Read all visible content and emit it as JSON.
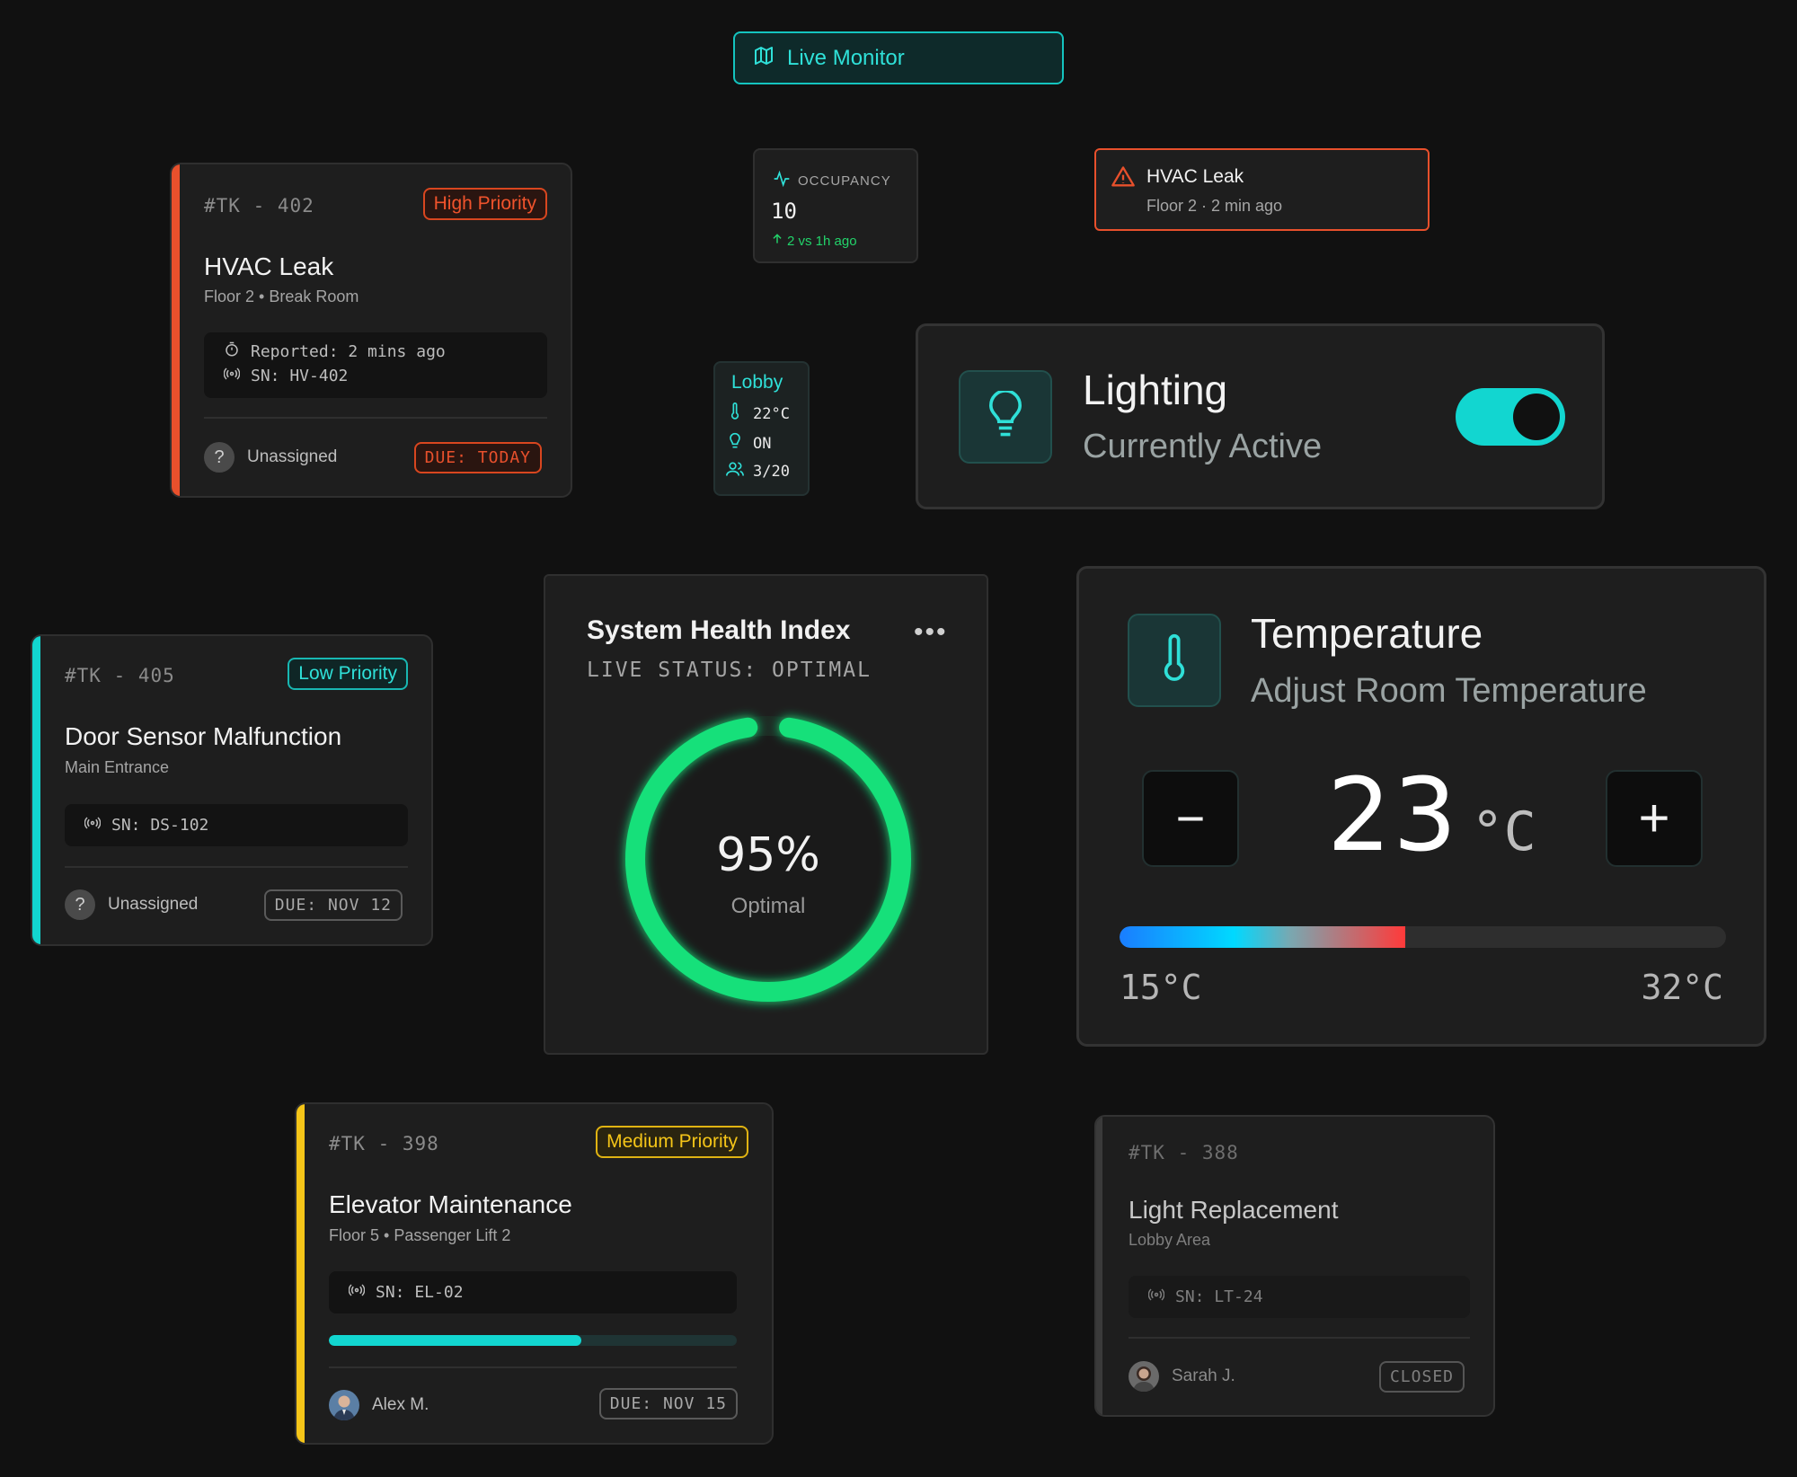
{
  "live_monitor": {
    "label": "Live Monitor",
    "icon": "map-icon"
  },
  "occupancy": {
    "label": "OCCUPANCY",
    "value": "10",
    "delta": "2 vs 1h ago",
    "icon": "activity-icon"
  },
  "alert": {
    "title": "HVAC Leak",
    "subtitle": "Floor 2 · 2 min ago",
    "icon": "warning-icon",
    "color": "#e8502c"
  },
  "lobby": {
    "title": "Lobby",
    "temp": "22°C",
    "light": "ON",
    "occupancy": "3/20"
  },
  "lighting": {
    "title": "Lighting",
    "status": "Currently Active",
    "toggle_on": true,
    "icon": "lightbulb-icon",
    "accent": "#12d6d0"
  },
  "health": {
    "title": "System Health Index",
    "status": "LIVE STATUS: OPTIMAL",
    "percent": 95,
    "percent_label": "95%",
    "state_label": "Optimal",
    "color": "#12e07a"
  },
  "temperature": {
    "title": "Temperature",
    "subtitle": "Adjust Room Temperature",
    "value": "23",
    "unit": "°C",
    "minus": "−",
    "plus": "+",
    "min_label": "15°C",
    "max_label": "32°C",
    "min": 15,
    "max": 32,
    "current": 23
  },
  "tickets": {
    "t402": {
      "id": "#TK - 402",
      "priority": "High Priority",
      "title": "HVAC Leak",
      "location": "Floor 2 • Break Room",
      "reported": "Reported: 2 mins ago",
      "serial": "SN: HV-402",
      "assignee": "Unassigned",
      "due": "DUE: TODAY",
      "accent": "#e8502c"
    },
    "t405": {
      "id": "#TK - 405",
      "priority": "Low Priority",
      "title": "Door Sensor Malfunction",
      "location": "Main Entrance",
      "serial": "SN: DS-102",
      "assignee": "Unassigned",
      "due": "DUE: NOV 12",
      "accent": "#12d6d0"
    },
    "t398": {
      "id": "#TK - 398",
      "priority": "Medium Priority",
      "title": "Elevator Maintenance",
      "location": "Floor 5 • Passenger Lift 2",
      "serial": "SN: EL-02",
      "progress": 0.62,
      "assignee": "Alex M.",
      "due": "DUE: NOV 15",
      "accent": "#f5c518"
    },
    "t388": {
      "id": "#TK - 388",
      "title": "Light Replacement",
      "location": "Lobby Area",
      "serial": "SN: LT-24",
      "assignee": "Sarah J.",
      "status": "CLOSED"
    }
  }
}
